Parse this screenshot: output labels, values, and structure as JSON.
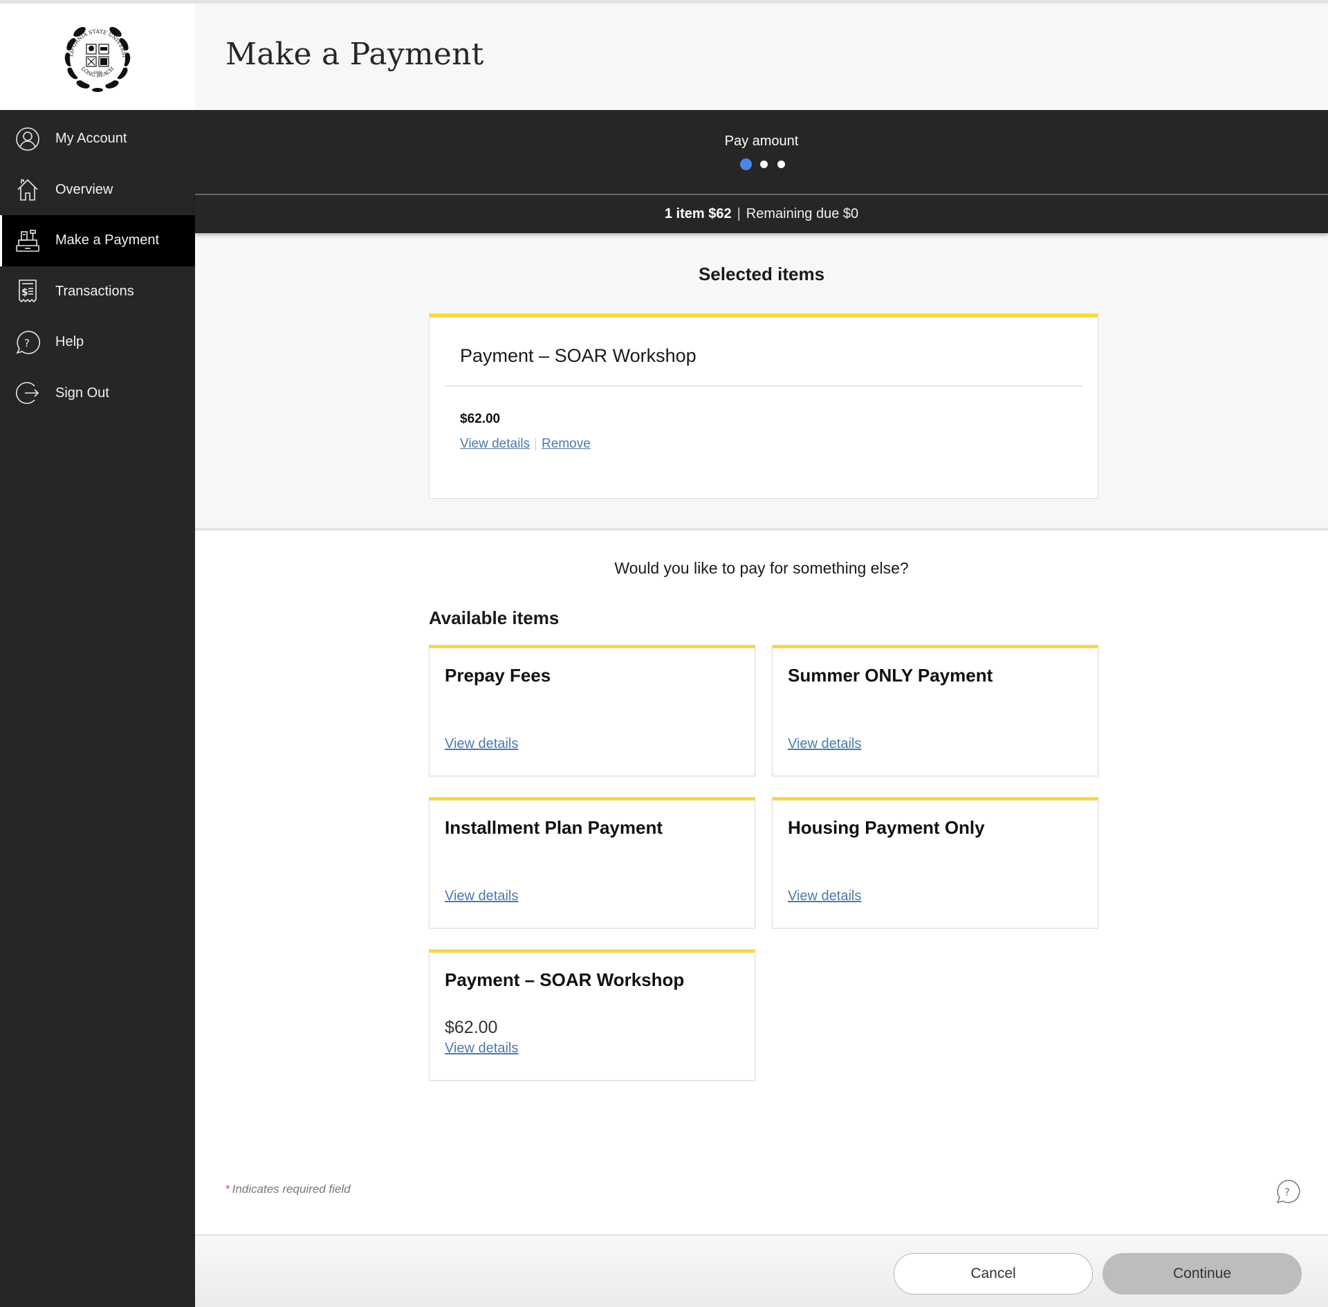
{
  "logo": {
    "alt": "California State University Long Beach seal",
    "ring_text_top": "CALIFORNIA STATE UNIVERSITY",
    "ring_text_bottom": "LONG BEACH",
    "year": "1949"
  },
  "header": {
    "title": "Make a Payment"
  },
  "sidebar": {
    "items": [
      {
        "label": "My Account",
        "icon": "user-circle-icon",
        "active": false
      },
      {
        "label": "Overview",
        "icon": "home-icon",
        "active": false
      },
      {
        "label": "Make a Payment",
        "icon": "cash-register-icon",
        "active": true
      },
      {
        "label": "Transactions",
        "icon": "receipt-icon",
        "active": false
      },
      {
        "label": "Help",
        "icon": "help-bubble-icon",
        "active": false
      },
      {
        "label": "Sign Out",
        "icon": "sign-out-icon",
        "active": false
      }
    ]
  },
  "stepper": {
    "current_step_label": "Pay amount",
    "total_steps": 3,
    "current_step": 1,
    "active_color": "#4a86e8"
  },
  "summary": {
    "items_text": "1 item $62",
    "separator": "|",
    "remaining_text": "Remaining due $0"
  },
  "selected": {
    "heading": "Selected items",
    "items": [
      {
        "title": "Payment – SOAR Workshop",
        "amount": "$62.00",
        "view_details": "View details",
        "remove": "Remove"
      }
    ]
  },
  "available": {
    "question": "Would you like to pay for something else?",
    "heading": "Available items",
    "items": [
      {
        "title": "Prepay Fees",
        "price": "",
        "link": "View details"
      },
      {
        "title": "Summer ONLY Payment",
        "price": "",
        "link": "View details"
      },
      {
        "title": "Installment Plan Payment",
        "price": "",
        "link": "View details"
      },
      {
        "title": "Housing Payment Only",
        "price": "",
        "link": "View details"
      },
      {
        "title": "Payment – SOAR Workshop",
        "price": "$62.00",
        "link": "View details"
      }
    ]
  },
  "footer": {
    "required_star": "*",
    "required_note": "Indicates required field",
    "cancel_label": "Cancel",
    "continue_label": "Continue"
  },
  "colors": {
    "accent_yellow": "#f9d64a",
    "link_blue": "#4a7aab",
    "sidebar_bg": "#262626",
    "active_step_blue": "#4a86e8"
  }
}
